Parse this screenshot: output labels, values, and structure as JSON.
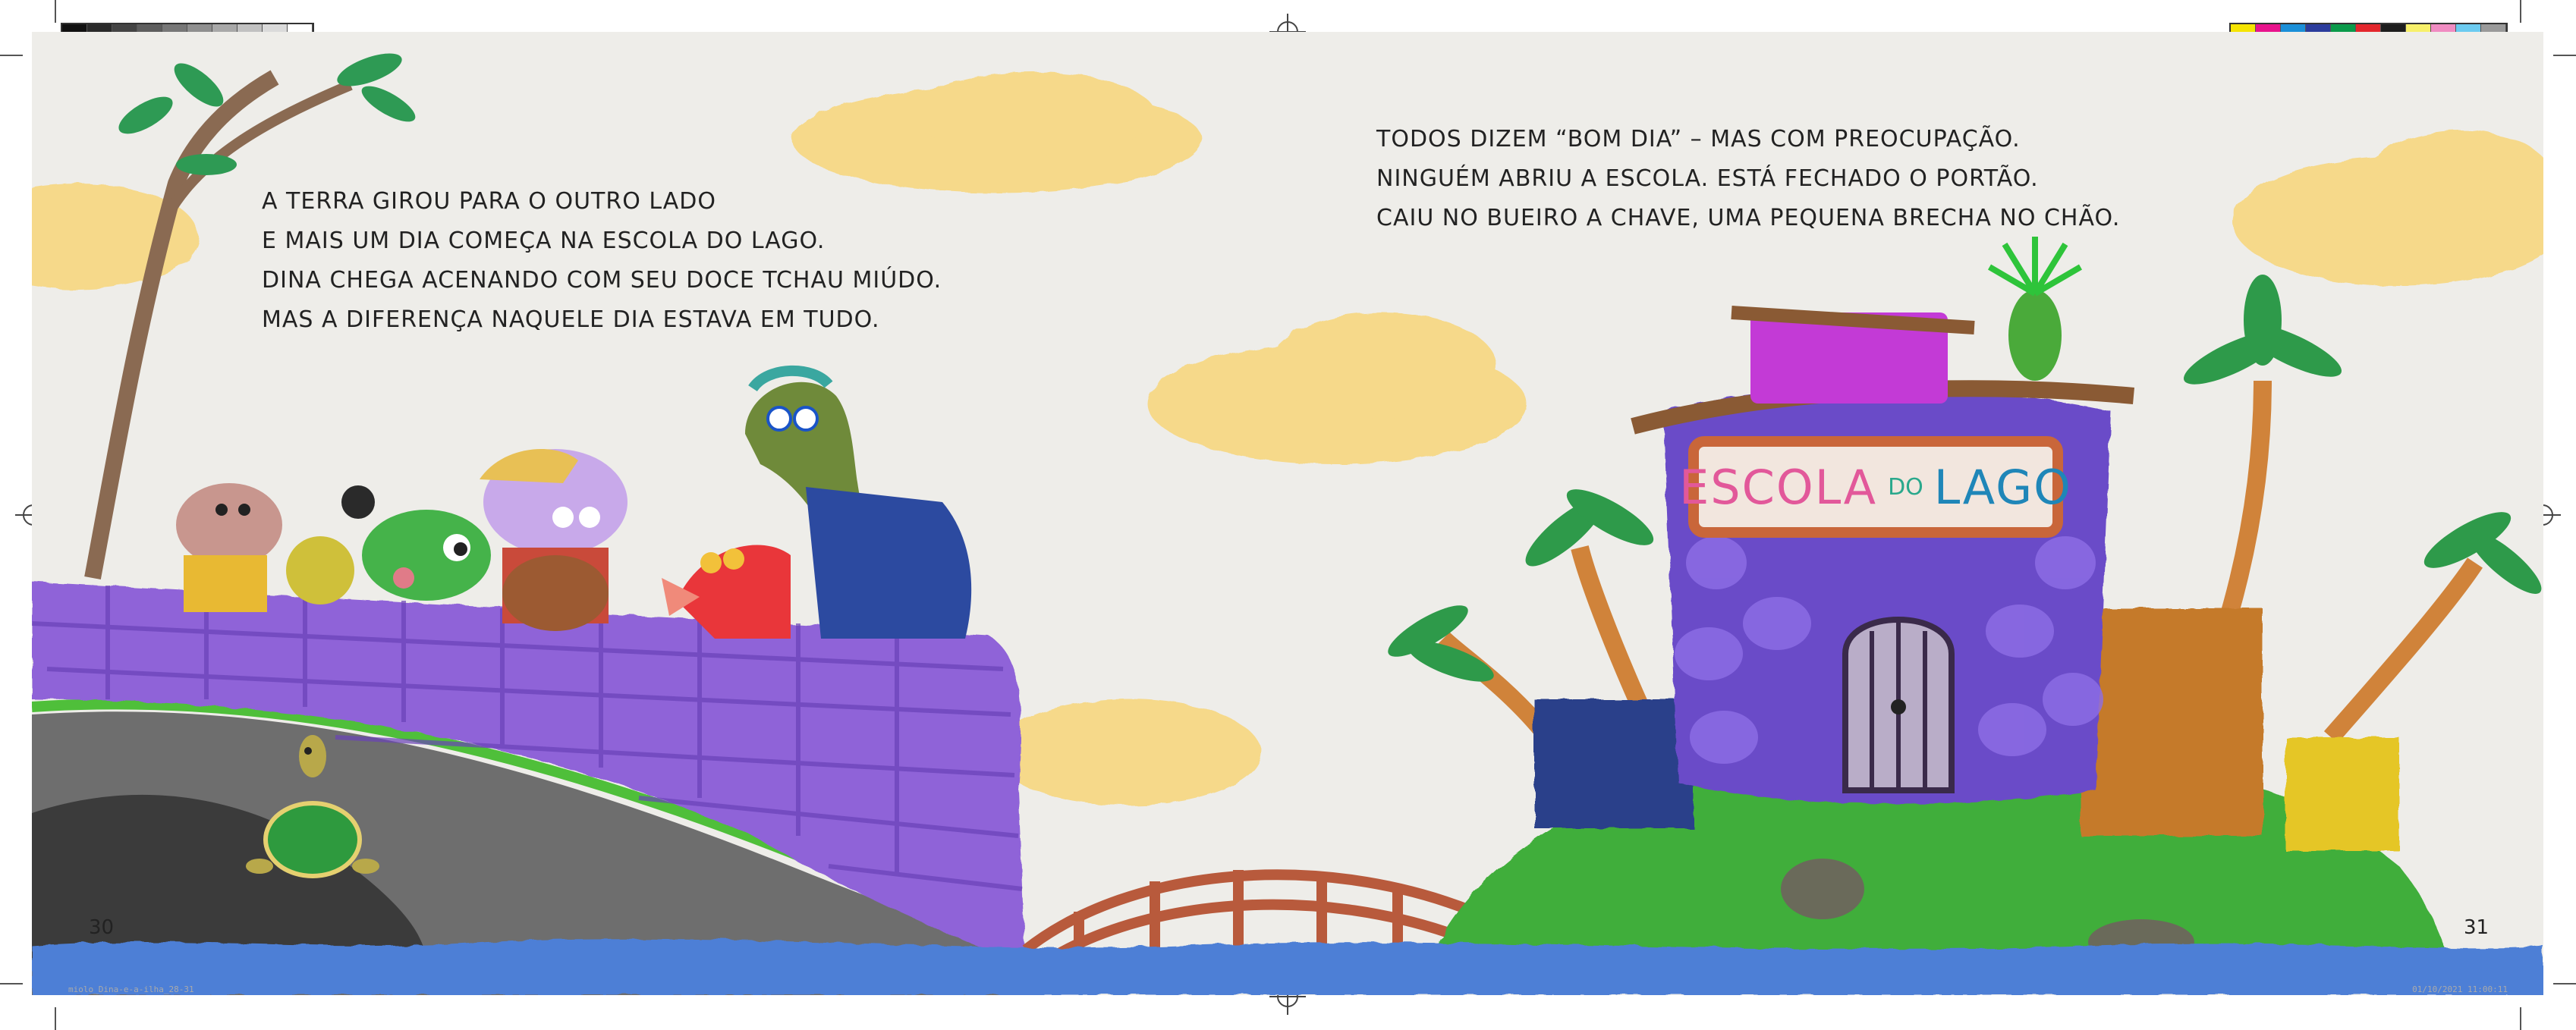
{
  "left_page": {
    "lines": [
      "A TERRA GIROU PARA O OUTRO LADO",
      "E MAIS UM DIA COMEÇA NA ESCOLA DO LAGO.",
      "DINA CHEGA ACENANDO COM SEU DOCE TCHAU MIÚDO.",
      "MAS A DIFERENÇA NAQUELE DIA ESTAVA EM TUDO."
    ],
    "page_number": "30"
  },
  "right_page": {
    "lines": [
      "TODOS DIZEM “BOM DIA” – MAS COM PREOCUPAÇÃO.",
      "NINGUÉM ABRIU A ESCOLA. ESTÁ FECHADO O PORTÃO.",
      "CAIU NO BUEIRO A CHAVE, UMA PEQUENA BRECHA NO CHÃO."
    ],
    "page_number": "31"
  },
  "school_sign": {
    "word_escola": "ESCOLA",
    "word_do": "DO",
    "word_lago": "LAGO"
  },
  "slug": {
    "left": "miolo_Dina-e-a-ilha_28-31",
    "right": "01/10/2021 11:00:11"
  },
  "colors": {
    "paper": "#eeede9",
    "water": "#4d7fd6",
    "wall": "#8f63d8",
    "grass": "#3fae3a",
    "cloud": "#f6d98a",
    "school": "#6a4bc8"
  },
  "color_bar": [
    "#f5e400",
    "#e8138c",
    "#1a8fd8",
    "#2b3c9c",
    "#0a9a4a",
    "#e3262c",
    "#1d1d1d",
    "#f7f06a",
    "#f08cc2",
    "#6ccbf0",
    "#9a9a9a"
  ],
  "gray_bar": [
    "#111111",
    "#2a2a2a",
    "#444444",
    "#5e5e5e",
    "#777777",
    "#8f8f8f",
    "#a8a8a8",
    "#c1c1c1",
    "#dadada",
    "#ffffff"
  ]
}
